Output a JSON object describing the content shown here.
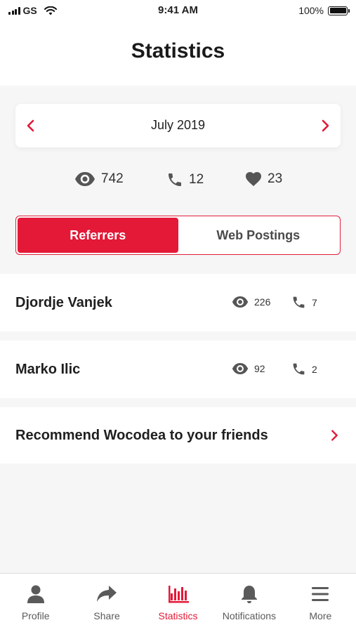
{
  "status_bar": {
    "carrier": "GS",
    "time": "9:41 AM",
    "battery": "100%",
    "battery_level": 1.0
  },
  "header": {
    "title": "Statistics"
  },
  "month_selector": {
    "label": "July 2019"
  },
  "summary": {
    "views": "742",
    "calls": "12",
    "likes": "23"
  },
  "tabs": [
    {
      "label": "Referrers",
      "active": true
    },
    {
      "label": "Web Postings",
      "active": false
    }
  ],
  "referrers": [
    {
      "name": "Djordje Vanjek",
      "views": "226",
      "calls": "7"
    },
    {
      "name": "Marko Ilic",
      "views": "92",
      "calls": "2"
    }
  ],
  "recommend": {
    "label": "Recommend Wocodea to your friends"
  },
  "bottom_nav": [
    {
      "label": "Profile",
      "icon": "person-icon",
      "active": false
    },
    {
      "label": "Share",
      "icon": "share-icon",
      "active": false
    },
    {
      "label": "Statistics",
      "icon": "statistics-icon",
      "active": true
    },
    {
      "label": "Notifications",
      "icon": "bell-icon",
      "active": false
    },
    {
      "label": "More",
      "icon": "menu-icon",
      "active": false
    }
  ],
  "colors": {
    "accent": "#e31937",
    "text": "#1f1f1f",
    "muted": "#5a5a5a",
    "background": "#f6f6f6"
  }
}
